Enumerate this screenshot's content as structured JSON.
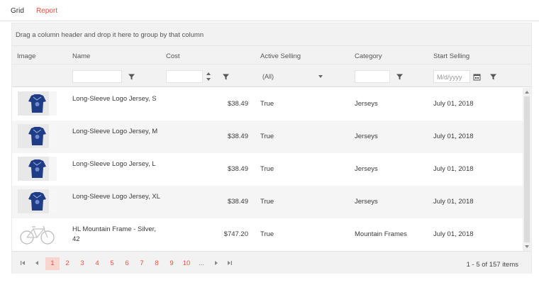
{
  "tabs": [
    {
      "label": "Grid"
    },
    {
      "label": "Report"
    }
  ],
  "accent_color": "#e9513c",
  "grid": {
    "group_panel_text": "Drag a column header and drop it here to group by that column",
    "columns": [
      "Image",
      "Name",
      "Cost",
      "Active Selling",
      "Category",
      "Start Selling"
    ],
    "filters": {
      "active_selling_value": "(All)",
      "date_placeholder": "M/d/yyyy"
    },
    "rows": [
      {
        "image": "jersey-image",
        "name": "Long-Sleeve Logo Jersey, S",
        "cost": "$38.49",
        "active": "True",
        "category": "Jerseys",
        "start": "July 01, 2018"
      },
      {
        "image": "jersey-image",
        "name": "Long-Sleeve Logo Jersey, M",
        "cost": "$38.49",
        "active": "True",
        "category": "Jerseys",
        "start": "July 01, 2018"
      },
      {
        "image": "jersey-image",
        "name": "Long-Sleeve Logo Jersey, L",
        "cost": "$38.49",
        "active": "True",
        "category": "Jerseys",
        "start": "July 01, 2018"
      },
      {
        "image": "jersey-image",
        "name": "Long-Sleeve Logo Jersey, XL",
        "cost": "$38.49",
        "active": "True",
        "category": "Jerseys",
        "start": "July 01, 2018"
      },
      {
        "image": "bike-image",
        "name": "HL Mountain Frame - Silver, 42",
        "cost": "$747.20",
        "active": "True",
        "category": "Mountain Frames",
        "start": "July 01, 2018"
      }
    ],
    "pager": {
      "pages": [
        "1",
        "2",
        "3",
        "4",
        "5",
        "6",
        "7",
        "8",
        "9",
        "10",
        "..."
      ],
      "current_page": "1",
      "info": "1 - 5 of 157 items"
    }
  }
}
